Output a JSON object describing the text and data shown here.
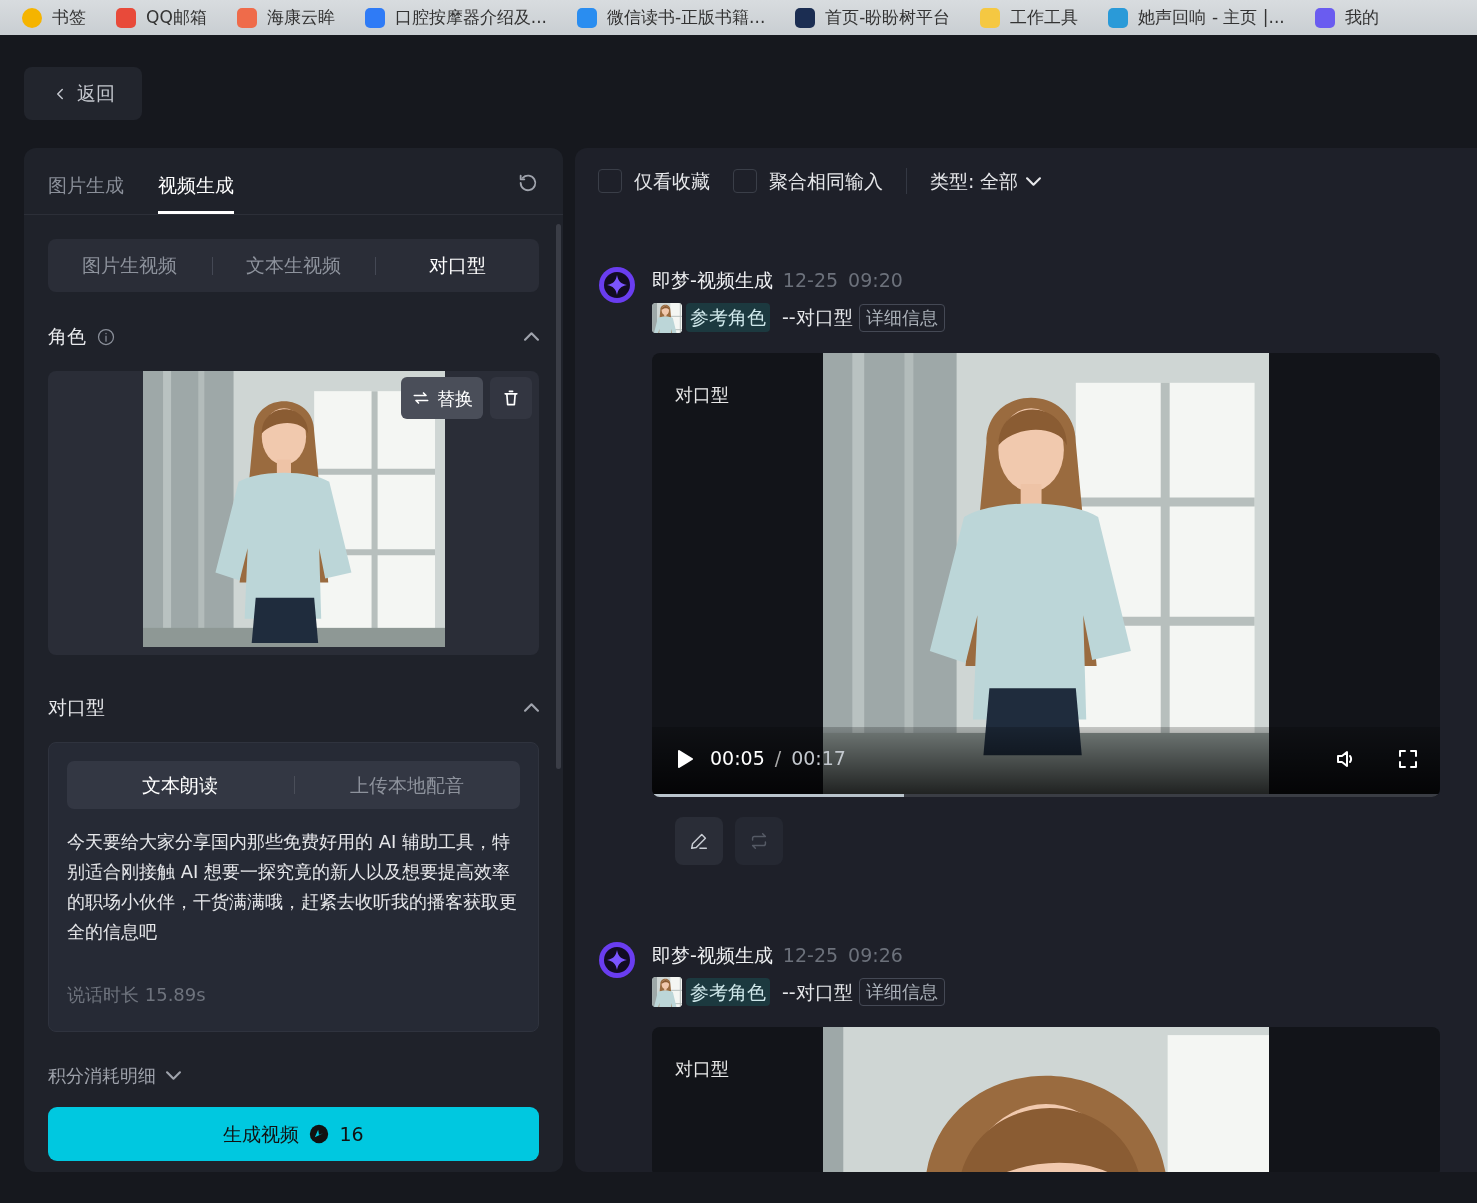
{
  "bookmarks": [
    {
      "label": "书签"
    },
    {
      "label": "QQ邮箱"
    },
    {
      "label": "海康云眸"
    },
    {
      "label": "口腔按摩器介绍及..."
    },
    {
      "label": "微信读书-正版书籍..."
    },
    {
      "label": "首页-盼盼树平台"
    },
    {
      "label": "工作工具"
    },
    {
      "label": "她声回响 - 主页 |..."
    },
    {
      "label": "我的"
    }
  ],
  "back_button": {
    "label": "返回"
  },
  "left_panel": {
    "tabs": [
      {
        "label": "图片生成",
        "selected": false
      },
      {
        "label": "视频生成",
        "selected": true
      }
    ],
    "modes": [
      {
        "label": "图片生视频",
        "selected": false
      },
      {
        "label": "文本生视频",
        "selected": false
      },
      {
        "label": "对口型",
        "selected": true
      }
    ],
    "character_section": {
      "title": "角色",
      "expanded": true,
      "replace_button": "替换"
    },
    "lipsync_section": {
      "title": "对口型",
      "expanded": true,
      "sources": [
        {
          "label": "文本朗读",
          "selected": true
        },
        {
          "label": "上传本地配音",
          "selected": false
        }
      ],
      "script": "今天要给大家分享国内那些免费好用的 AI 辅助工具，特别适合刚接触 AI 想要一探究竟的新人以及想要提高效率的职场小伙伴，干货满满哦，赶紧去收听我的播客获取更全的信息吧",
      "duration": "说话时长 15.89s"
    },
    "cost_details": {
      "label": "积分消耗明细",
      "expanded": false
    },
    "generate_button": {
      "label": "生成视频",
      "cost": "16"
    }
  },
  "right_panel": {
    "filters": [
      {
        "label": "仅看收藏",
        "checked": false
      },
      {
        "label": "聚合相同输入",
        "checked": false
      }
    ],
    "type_dropdown": "类型: 全部",
    "results": [
      {
        "source": "即梦-视频生成",
        "date": "12-25",
        "time": "09:20",
        "tag": "参考角色",
        "mode": "--对口型",
        "detail_button": "详细信息",
        "video": {
          "label": "对口型",
          "controls": {
            "playing": false,
            "current": "00:05",
            "separator": "/",
            "total": "00:17",
            "level": 0.32
          }
        }
      },
      {
        "source": "即梦-视频生成",
        "date": "12-25",
        "time": "09:26",
        "tag": "参考角色",
        "mode": "--对口型",
        "detail_button": "详细信息",
        "video": {
          "label": "对口型"
        }
      }
    ]
  }
}
